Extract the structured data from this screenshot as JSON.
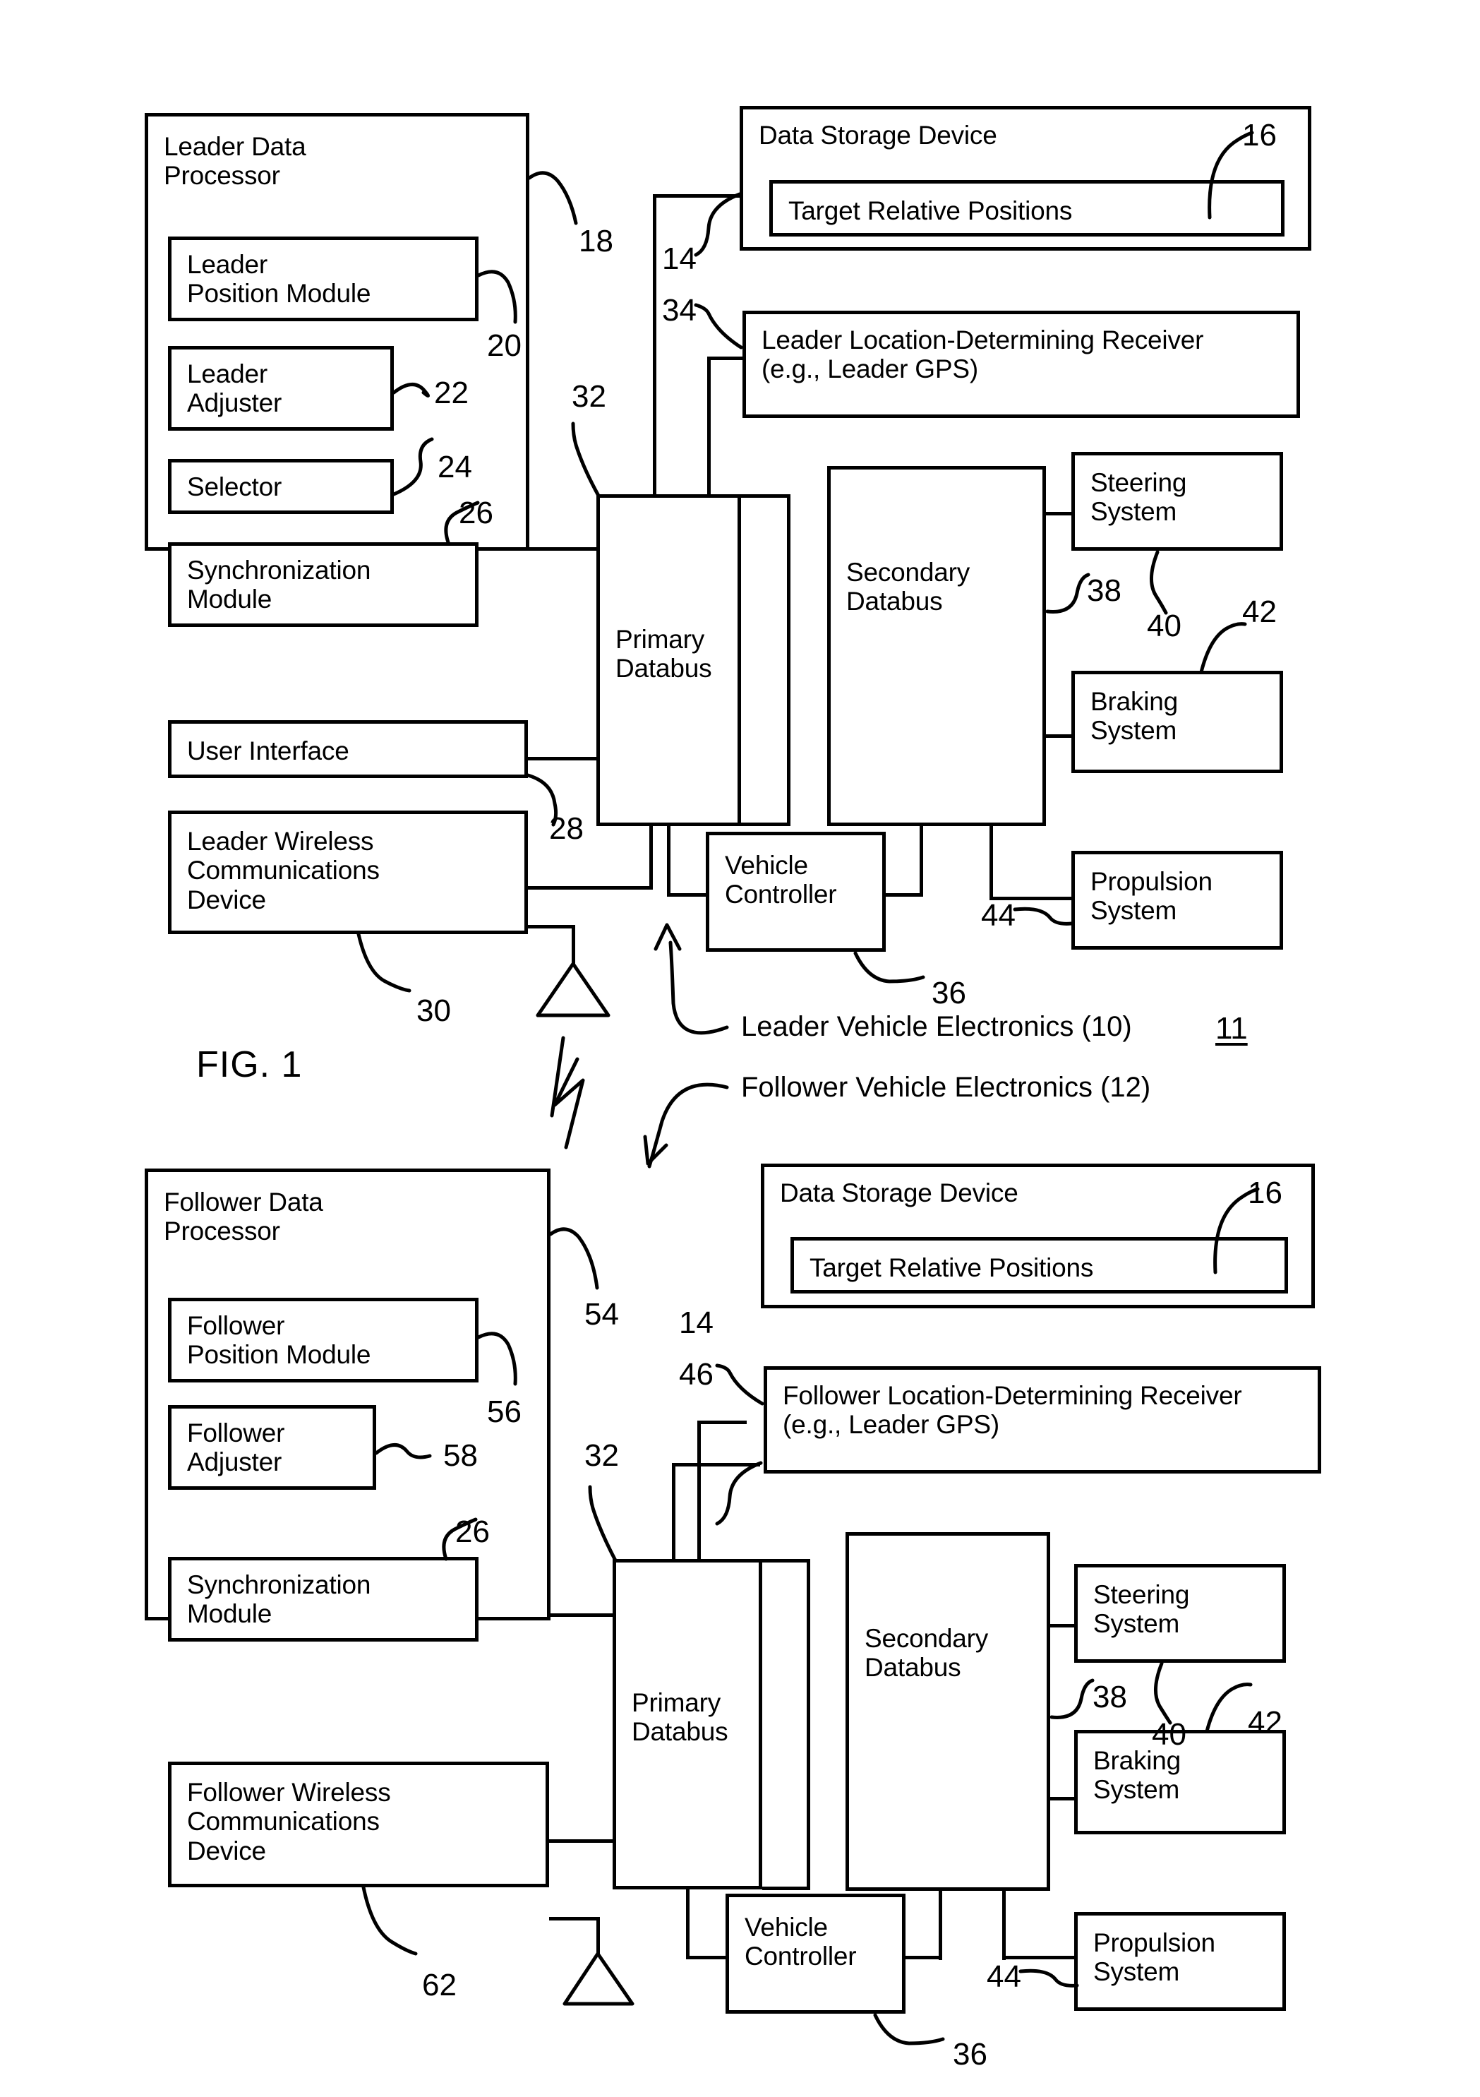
{
  "document": {
    "type": "patent-block-diagram",
    "figures": [
      {
        "id": "fig1",
        "label": "FIG. 1",
        "system_ref": "11",
        "group_captions": [
          {
            "text": "Leader Vehicle Electronics (10)",
            "arrow": "up"
          },
          {
            "text": "Follower Vehicle Electronics (12)",
            "arrow": "down"
          }
        ],
        "blocks": {
          "data_processor": {
            "title": "Leader Data\nProcessor",
            "ref": "18",
            "children": [
              {
                "title": "Leader\nPosition Module",
                "ref": "20"
              },
              {
                "title": "Leader\nAdjuster",
                "ref": "22"
              },
              {
                "title": "Selector",
                "ref": "24"
              },
              {
                "title": "Synchronization\nModule",
                "ref": "26"
              }
            ]
          },
          "user_interface": {
            "title": "User Interface",
            "ref": "28"
          },
          "wireless": {
            "title": "Leader Wireless\nCommunications\nDevice",
            "ref": "30"
          },
          "storage": {
            "title": "Data Storage Device",
            "ref": "14",
            "child": {
              "title": "Target Relative Positions",
              "ref": "16"
            }
          },
          "receiver": {
            "title": "Leader Location-Determining Receiver\n(e.g., Leader GPS)",
            "ref": "34"
          },
          "primary_databus": {
            "title": "Primary\nDatabus",
            "ref": "32"
          },
          "secondary_databus": {
            "title": "Secondary\nDatabus",
            "ref": "38"
          },
          "vehicle_controller": {
            "title": "Vehicle\nController",
            "ref": "36"
          },
          "steering": {
            "title": "Steering\nSystem",
            "ref": "40"
          },
          "braking": {
            "title": "Braking\nSystem",
            "ref": "42"
          },
          "propulsion": {
            "title": "Propulsion\nSystem",
            "ref": "44"
          }
        }
      },
      {
        "id": "fig2",
        "label": "",
        "blocks": {
          "data_processor": {
            "title": "Follower Data\nProcessor",
            "ref": "54",
            "children": [
              {
                "title": "Follower\nPosition Module",
                "ref": "56"
              },
              {
                "title": "Follower\nAdjuster",
                "ref": "58"
              },
              {
                "title": "Synchronization\nModule",
                "ref": "26"
              }
            ]
          },
          "wireless": {
            "title": "Follower Wireless\nCommunications\nDevice",
            "ref": "62"
          },
          "storage": {
            "title": "Data Storage Device",
            "ref": "14",
            "child": {
              "title": "Target Relative Positions",
              "ref": "16"
            }
          },
          "receiver": {
            "title": "Follower Location-Determining Receiver\n(e.g., Leader GPS)",
            "ref": "46"
          },
          "primary_databus": {
            "title": "Primary\nDatabus",
            "ref": "32"
          },
          "secondary_databus": {
            "title": "Secondary\nDatabus",
            "ref": "38"
          },
          "vehicle_controller": {
            "title": "Vehicle\nController",
            "ref": "36"
          },
          "steering": {
            "title": "Steering\nSystem",
            "ref": "40"
          },
          "braking": {
            "title": "Braking\nSystem",
            "ref": "42"
          },
          "propulsion": {
            "title": "Propulsion\nSystem",
            "ref": "44"
          }
        }
      }
    ],
    "colors": {
      "ink": "#000000",
      "paper": "#ffffff"
    }
  }
}
